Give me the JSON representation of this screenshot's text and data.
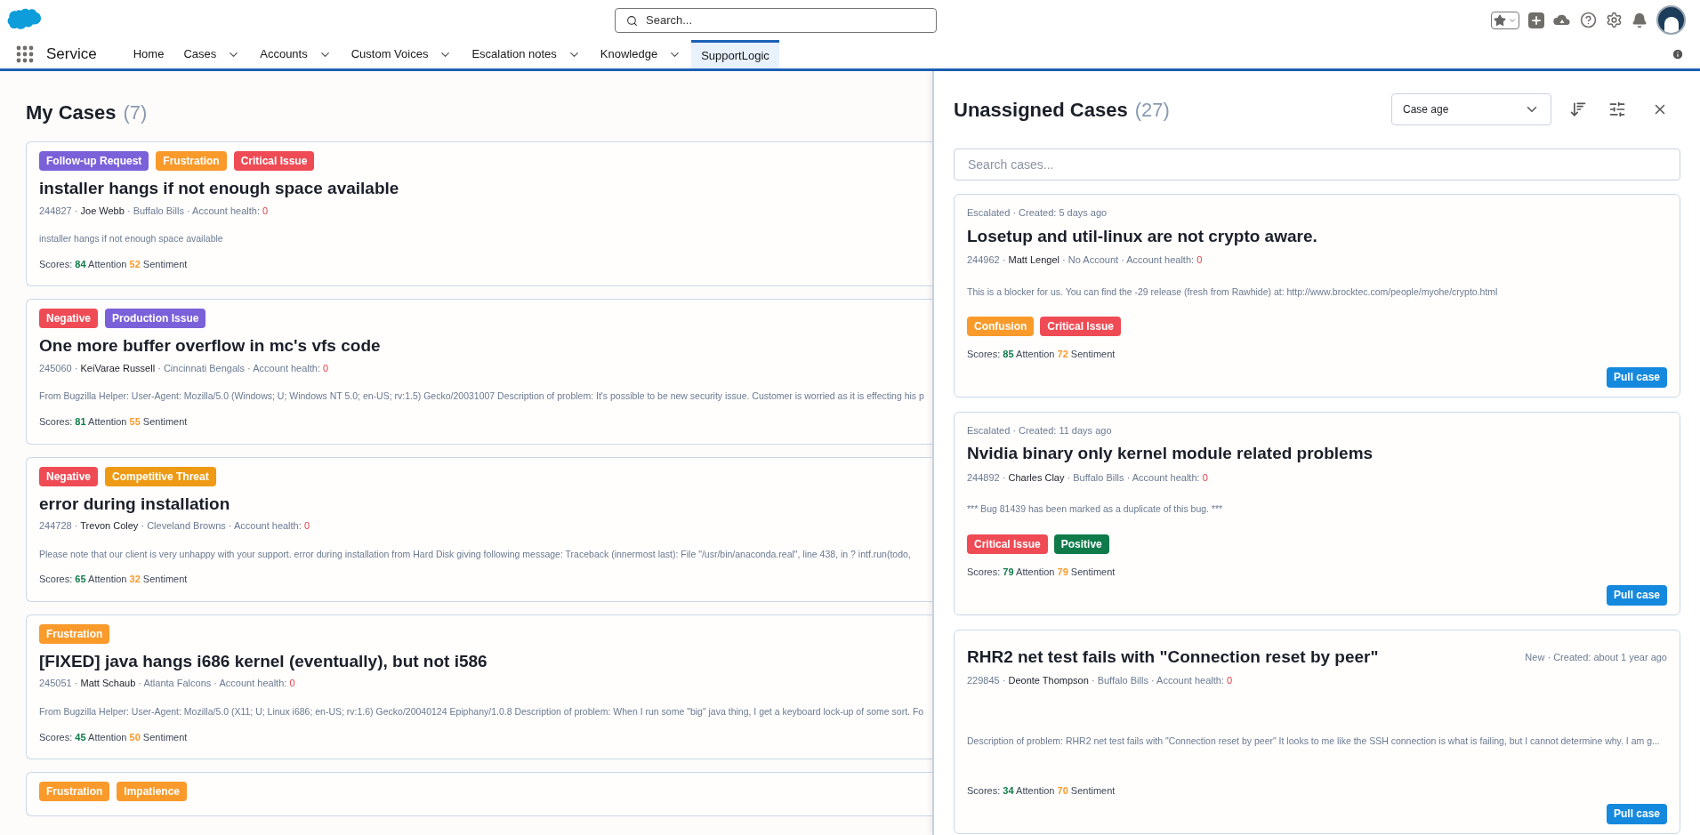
{
  "header": {
    "search_placeholder": "Search..."
  },
  "nav": {
    "app_name": "Service",
    "tabs": [
      {
        "label": "Home",
        "menu": false,
        "selected": false
      },
      {
        "label": "Cases",
        "menu": true,
        "selected": false
      },
      {
        "label": "Accounts",
        "menu": true,
        "selected": false
      },
      {
        "label": "Custom Voices",
        "menu": true,
        "selected": false
      },
      {
        "label": "Escalation notes",
        "menu": true,
        "selected": false
      },
      {
        "label": "Knowledge",
        "menu": true,
        "selected": false
      },
      {
        "label": "SupportLogic",
        "menu": false,
        "selected": true
      }
    ]
  },
  "separator": "·",
  "my_cases": {
    "title": "My Cases",
    "count": "(7)",
    "cases": [
      {
        "tags": [
          {
            "label": "Follow-up Request",
            "color": "#7b61d9"
          },
          {
            "label": "Frustration",
            "color": "#f99a2b"
          },
          {
            "label": "Critical Issue",
            "color": "#ef4b55"
          }
        ],
        "title": "installer hangs if not enough space available",
        "id": "244827",
        "contact": "Joe Webb",
        "account": "Buffalo Bills",
        "health_label": "Account health:",
        "health": "0",
        "description": "installer hangs if not enough space available",
        "scores_label": "Scores:",
        "attention": "84",
        "attention_label": "Attention",
        "sentiment": "52",
        "sentiment_label": "Sentiment"
      },
      {
        "tags": [
          {
            "label": "Negative",
            "color": "#ef4b55"
          },
          {
            "label": "Production Issue",
            "color": "#7b61d9"
          }
        ],
        "title": "One more buffer overflow in mc's vfs code",
        "id": "245060",
        "contact": "KeiVarae Russell",
        "account": "Cincinnati Bengals",
        "health_label": "Account health:",
        "health": "0",
        "description": "From Bugzilla Helper: User-Agent: Mozilla/5.0 (Windows; U; Windows NT 5.0; en-US; rv:1.5) Gecko/20031007 Description of problem: It's possible to be new security issue. Customer is worried as it is effecting his p",
        "scores_label": "Scores:",
        "attention": "81",
        "attention_label": "Attention",
        "sentiment": "55",
        "sentiment_label": "Sentiment"
      },
      {
        "tags": [
          {
            "label": "Negative",
            "color": "#ef4b55"
          },
          {
            "label": "Competitive Threat",
            "color": "#ef9a14"
          }
        ],
        "title": "error during installation",
        "id": "244728",
        "contact": "Trevon Coley",
        "account": "Cleveland Browns",
        "health_label": "Account health:",
        "health": "0",
        "description": "Please note that our client is very unhappy with your support. error during installation from Hard Disk giving following message: Traceback (innermost last): File \"/usr/bin/anaconda.real\", line 438, in ? intf.run(todo,",
        "scores_label": "Scores:",
        "attention": "65",
        "attention_label": "Attention",
        "sentiment": "32",
        "sentiment_label": "Sentiment"
      },
      {
        "tags": [
          {
            "label": "Frustration",
            "color": "#f99a2b"
          }
        ],
        "title": "[FIXED] java hangs i686 kernel (eventually), but not i586",
        "id": "245051",
        "contact": "Matt Schaub",
        "account": "Atlanta Falcons",
        "health_label": "Account health:",
        "health": "0",
        "description": "From Bugzilla Helper: User-Agent: Mozilla/5.0 (X11; U; Linux i686; en-US; rv:1.6) Gecko/20040124 Epiphany/1.0.8 Description of problem: When I run some \"big\" java thing, I get a keyboard lock-up of some sort. Fo",
        "scores_label": "Scores:",
        "attention": "45",
        "attention_label": "Attention",
        "sentiment": "50",
        "sentiment_label": "Sentiment"
      },
      {
        "tags": [
          {
            "label": "Frustration",
            "color": "#f99a2b"
          },
          {
            "label": "Impatience",
            "color": "#f99a2b"
          }
        ]
      }
    ]
  },
  "unassigned": {
    "title": "Unassigned Cases",
    "count": "(27)",
    "sort": "Case age",
    "search_placeholder": "Search cases...",
    "cases": [
      {
        "kind": "status-top",
        "status": "Escalated",
        "created_label": "Created:",
        "created": "5 days ago",
        "title": "Losetup and util-linux are not crypto aware.",
        "id": "244962",
        "contact": "Matt Lengel",
        "account": "No Account",
        "health_label": "Account health:",
        "health": "0",
        "description": "This is a blocker for us. You can find the -29 release (fresh from Rawhide) at: http://www.brocktec.com/people/myohe/crypto.html",
        "tags": [
          {
            "label": "Confusion",
            "color": "#f99a2b"
          },
          {
            "label": "Critical Issue",
            "color": "#ef4b55"
          }
        ],
        "scores_label": "Scores:",
        "attention": "85",
        "attention_label": "Attention",
        "sentiment": "72",
        "sentiment_label": "Sentiment",
        "button": "Pull case"
      },
      {
        "kind": "status-top",
        "status": "Escalated",
        "created_label": "Created:",
        "created": "11 days ago",
        "title": "Nvidia binary only kernel module related problems",
        "id": "244892",
        "contact": "Charles Clay",
        "account": "Buffalo Bills",
        "health_label": "Account health:",
        "health": "0",
        "description": "*** Bug 81439 has been marked as a duplicate of this bug. ***",
        "tags": [
          {
            "label": "Critical Issue",
            "color": "#ef4b55"
          },
          {
            "label": "Positive",
            "color": "#0f7a4a"
          }
        ],
        "scores_label": "Scores:",
        "attention": "79",
        "attention_label": "Attention",
        "sentiment": "79",
        "sentiment_label": "Sentiment",
        "button": "Pull case"
      },
      {
        "kind": "status-right",
        "status": "New",
        "created_label": "Created:",
        "created": "about 1 year ago",
        "title": "RHR2 net test fails with \"Connection reset by peer\"",
        "id": "229845",
        "contact": "Deonte Thompson",
        "account": "Buffalo Bills",
        "health_label": "Account health:",
        "health": "0",
        "description": "Description of problem: RHR2 net test fails with \"Connection reset by peer\" It looks to me like the SSH connection is what is failing, but I cannot determine why. I am g...",
        "scores_label": "Scores:",
        "attention": "34",
        "attention_label": "Attention",
        "sentiment": "70",
        "sentiment_label": "Sentiment",
        "button": "Pull case"
      }
    ]
  }
}
